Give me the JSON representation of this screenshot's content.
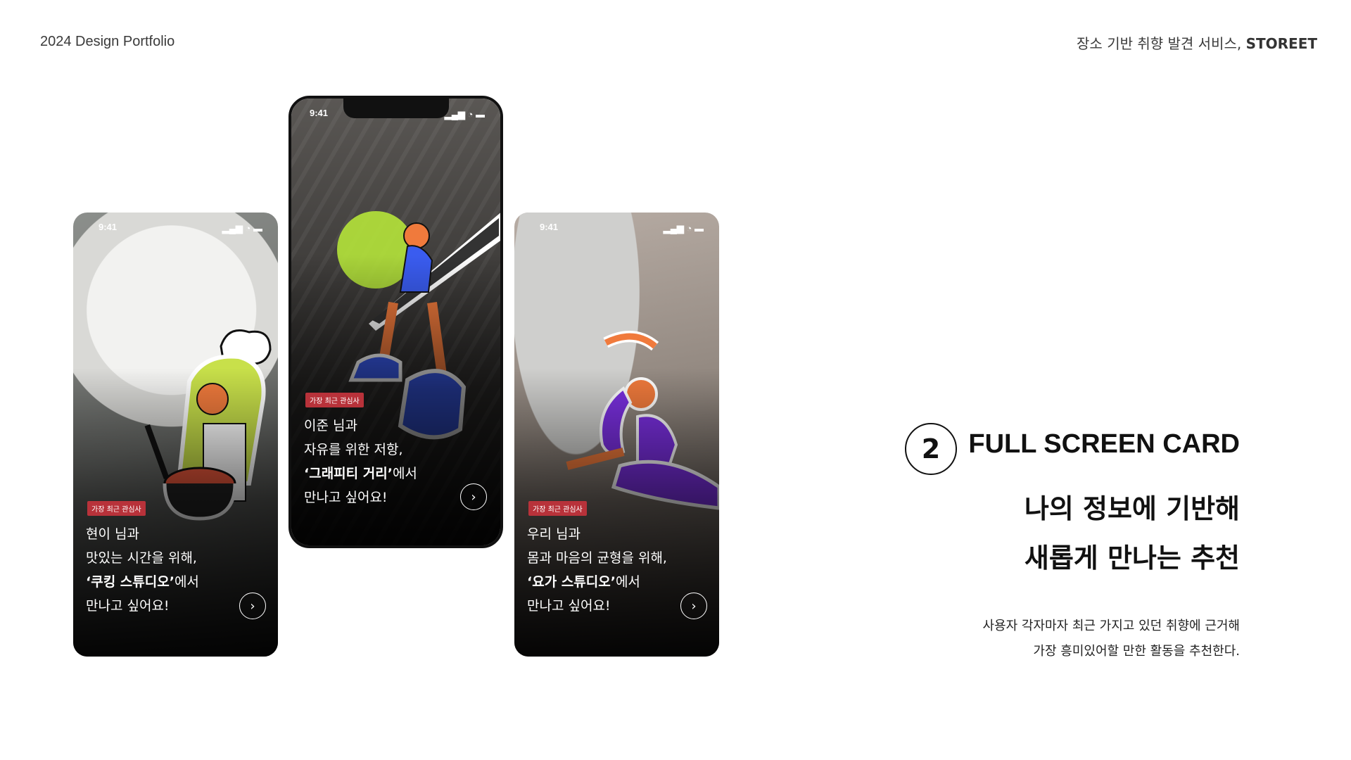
{
  "header": {
    "left": "2024 Design Portfolio",
    "right_prefix": "장소 기반 취향 발견 서비스, ",
    "right_brand": "STOREET"
  },
  "phones": [
    {
      "time": "9:41",
      "badge": "가장 최근 관심사",
      "name": "현이 님과",
      "line1": "맛있는 시간을 위해,",
      "place": "‘쿠킹 스튜디오’",
      "place_suffix": "에서",
      "line3": "만나고 싶어요!",
      "arrow": "›"
    },
    {
      "time": "9:41",
      "badge": "가장 최근 관심사",
      "name": "이준 님과",
      "line1": "자유를 위한 저항,",
      "place": "‘그래피티 거리’",
      "place_suffix": "에서",
      "line3": "만나고 싶어요!",
      "arrow": "›"
    },
    {
      "time": "9:41",
      "badge": "가장 최근 관심사",
      "name": "우리 님과",
      "line1": "몸과 마음의 균형을 위해,",
      "place": "‘요가 스튜디오’",
      "place_suffix": "에서",
      "line3": "만나고 싶어요!",
      "arrow": "›"
    }
  ],
  "feature": {
    "number": "2",
    "title": "FULL SCREEN CARD",
    "subtitle_line1": "나의 정보에 기반해",
    "subtitle_line2": "새롭게 만나는 추천",
    "desc_line1": "사용자 각자마자 최근 가지고 있던 취향에 근거해",
    "desc_line2": "가장 흥미있어할 만한 활동을 추천한다."
  },
  "colors": {
    "badge": "#b8323a",
    "chef_accent": "#c8e04a",
    "graffiti_accent": "#3a5cf0",
    "yoga_accent": "#7a2fe0"
  }
}
